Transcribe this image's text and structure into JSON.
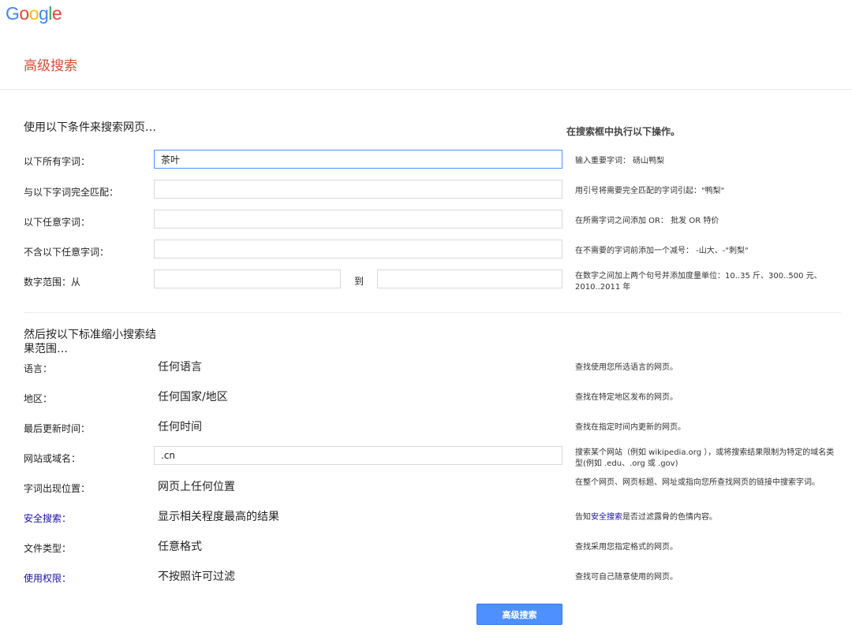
{
  "brand": {
    "letters": [
      {
        "char": "G",
        "color": "#4285f4"
      },
      {
        "char": "o",
        "color": "#ea4335"
      },
      {
        "char": "o",
        "color": "#fbbc05"
      },
      {
        "char": "g",
        "color": "#4285f4"
      },
      {
        "char": "l",
        "color": "#34a853"
      },
      {
        "char": "e",
        "color": "#ea4335"
      }
    ]
  },
  "page": {
    "title": "高级搜索",
    "hint_heading": "在搜索框中执行以下操作。"
  },
  "section1": {
    "heading": "使用以下条件来搜索网页…",
    "fields": [
      {
        "label": "以下所有字词：",
        "value": "茶叶",
        "hint": "输入重要字词： 砀山鸭梨"
      },
      {
        "label": "与以下字词完全匹配：",
        "value": "",
        "hint": "用引号将需要完全匹配的字词引起：\"鸭梨\""
      },
      {
        "label": "以下任意字词：",
        "value": "",
        "hint": "在所需字词之间添加 OR： 批发 OR 特价"
      },
      {
        "label": "不含以下任意字词：",
        "value": "",
        "hint": "在不需要的字词前添加一个减号： -山大、-\"刺梨\""
      }
    ],
    "range": {
      "label": "数字范围：从",
      "to_label": "到",
      "from_value": "",
      "to_value": "",
      "hint": "在数字之间加上两个句号并添加度量单位：10..35 斤、300..500 元、2010..2011 年"
    }
  },
  "section2": {
    "heading": "然后按以下标准缩小搜索结果范围…",
    "language": {
      "label": "语言：",
      "value": "任何语言",
      "hint": "查找使用您所选语言的网页。"
    },
    "region": {
      "label": "地区：",
      "value": "任何国家/地区",
      "hint": "查找在特定地区发布的网页。"
    },
    "last_update": {
      "label": "最后更新时间：",
      "value": "任何时间",
      "hint": "查找在指定时间内更新的网页。"
    },
    "site": {
      "label": "网站或域名：",
      "value": ".cn",
      "hint": "搜索某个网站（例如 wikipedia.org ），或将搜索结果限制为特定的域名类型(例如 .edu、.org 或 .gov)"
    },
    "terms_appear": {
      "label": "字词出现位置：",
      "value": "网页上任何位置",
      "hint": "在整个网页、网页标题、网址或指向您所查找网页的链接中搜索字词。"
    },
    "safesearch": {
      "label": "安全搜索：",
      "value": "显示相关程度最高的结果",
      "hint_pre": "告知",
      "hint_link": "安全搜索",
      "hint_post": "是否过滤露骨的色情内容。"
    },
    "file_type": {
      "label": "文件类型：",
      "value": "任意格式",
      "hint": "查找采用您指定格式的网页。"
    },
    "usage_rights": {
      "label": "使用权限：",
      "value": "不按照许可过滤",
      "hint": "查找可自己随意使用的网页。"
    }
  },
  "submit_label": "高级搜索",
  "colors": {
    "accent": "#4d90fe",
    "title": "#dd4b39",
    "link": "#1a0dab"
  }
}
